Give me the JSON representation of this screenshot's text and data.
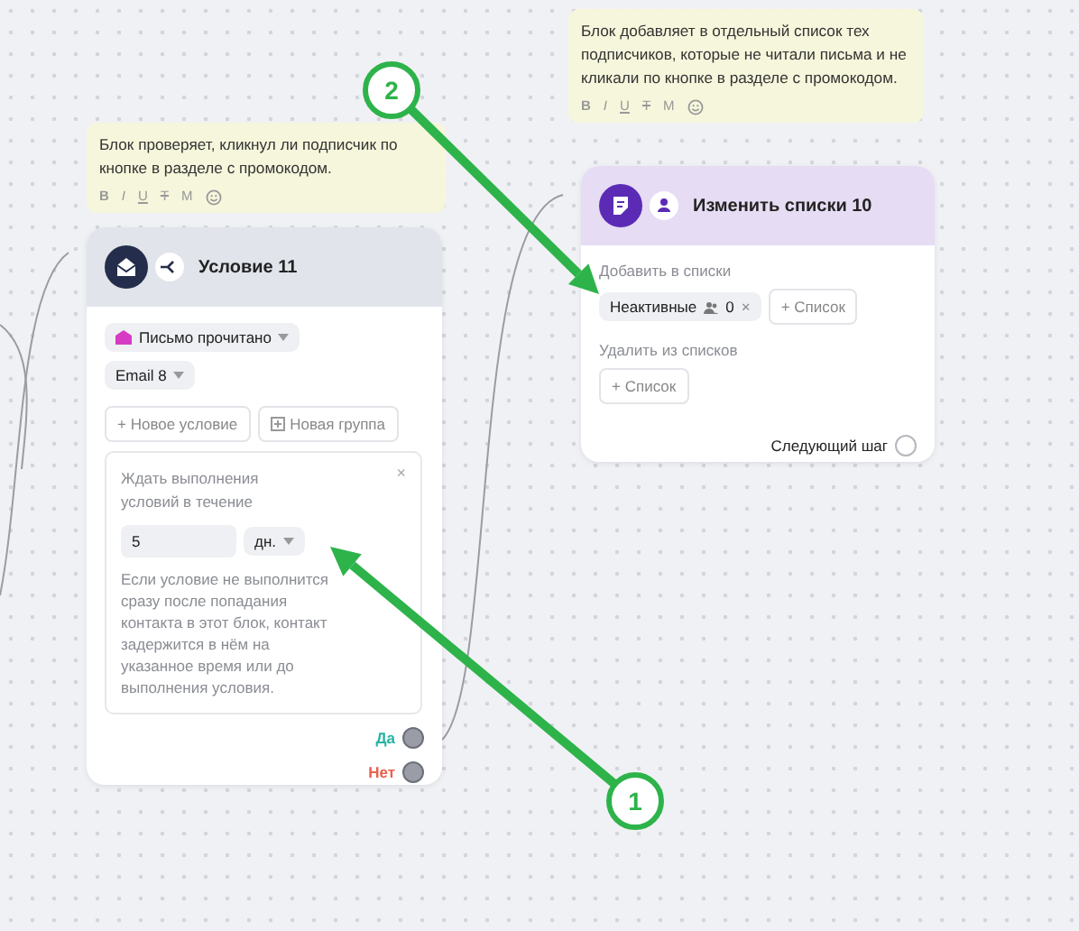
{
  "notes": [
    {
      "text": "Блок проверяет, кликнул ли подписчик по кнопке в разделе с промокодом.",
      "format_buttons": [
        {
          "kind": "bold",
          "label": "B"
        },
        {
          "kind": "italic",
          "label": "I"
        },
        {
          "kind": "underline",
          "label": "U"
        },
        {
          "kind": "strike",
          "label": "T"
        },
        {
          "kind": "plain",
          "label": "M"
        }
      ]
    },
    {
      "text": "Блок добавляет в отдельный список тех подписчиков, которые не читали письма и не кликали по кнопке в разделе с промокодом.",
      "format_buttons": [
        {
          "kind": "bold",
          "label": "B"
        },
        {
          "kind": "italic",
          "label": "I"
        },
        {
          "kind": "underline",
          "label": "U"
        },
        {
          "kind": "strike",
          "label": "T"
        },
        {
          "kind": "plain",
          "label": "M"
        }
      ]
    }
  ],
  "condition_node": {
    "title": "Условие 11",
    "event": "Письмо прочитано",
    "email": "Email 8",
    "new_condition": "+ Новое условие",
    "new_group": "Новая группа",
    "wait": {
      "title": "Ждать выполнения условий в течение",
      "value": "5",
      "unit": "дн.",
      "close": "×",
      "hint": "Если условие не выполнится сразу после попадания контакта в этот блок, контакт задержится в нём на указанное время или до выполнения условия."
    },
    "outputs": [
      {
        "label": "Да",
        "color": "#27b3a6"
      },
      {
        "label": "Нет",
        "color": "#e8604c"
      }
    ]
  },
  "list_node": {
    "title": "Изменить списки 10",
    "add_label": "Добавить в списки",
    "add_tags": [
      {
        "name": "Неактивные",
        "count": "0",
        "remove": "×"
      }
    ],
    "add_button": "+ Список",
    "remove_label": "Удалить из списков",
    "remove_button": "+ Список",
    "next_step": "Следующий шаг"
  },
  "callouts": [
    {
      "number": "1"
    },
    {
      "number": "2"
    }
  ]
}
